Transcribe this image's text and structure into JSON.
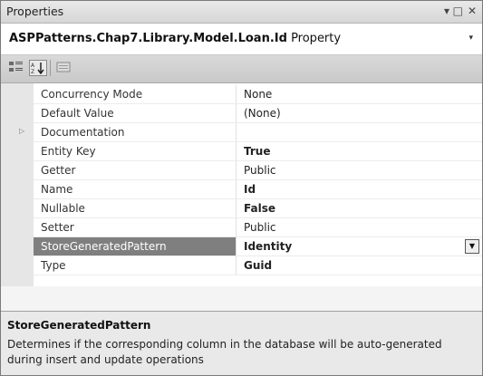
{
  "window": {
    "title": "Properties",
    "controls": {
      "dropdown_glyph": "▾",
      "pin_glyph": "□",
      "close_glyph": "✕"
    }
  },
  "object_selector": {
    "object_name": "ASPPatterns.Chap7.Library.Model.Loan.Id",
    "object_type": "Property",
    "arrow_glyph": "▾"
  },
  "toolbar": {
    "buttons": [
      {
        "name": "categorized",
        "icon": "categorized-icon",
        "selected": false
      },
      {
        "name": "alphabetical",
        "icon": "alphabetical-sort-icon",
        "selected": true
      },
      {
        "name": "property-pages",
        "icon": "property-pages-icon",
        "selected": false
      }
    ]
  },
  "properties": [
    {
      "name": "Concurrency Mode",
      "value": "None",
      "bold": false
    },
    {
      "name": "Default Value",
      "value": "(None)",
      "bold": false
    },
    {
      "name": "Documentation",
      "value": "",
      "bold": false,
      "expander": "▷"
    },
    {
      "name": "Entity Key",
      "value": "True",
      "bold": true
    },
    {
      "name": "Getter",
      "value": "Public",
      "bold": false
    },
    {
      "name": "Name",
      "value": "Id",
      "bold": true
    },
    {
      "name": "Nullable",
      "value": "False",
      "bold": true
    },
    {
      "name": "Setter",
      "value": "Public",
      "bold": false
    },
    {
      "name": "StoreGeneratedPattern",
      "value": "Identity",
      "bold": true,
      "selected": true,
      "dropdown_glyph": "▼"
    },
    {
      "name": "Type",
      "value": "Guid",
      "bold": true
    }
  ],
  "description": {
    "title": "StoreGeneratedPattern",
    "text": "Determines if the corresponding column in the database will be auto-generated during insert and update operations"
  },
  "colors": {
    "selected_row": "#7f7f7f",
    "gutter": "#e6e6e6",
    "toolbar": "#d0d0d0",
    "description_bg": "#e9e9e9"
  }
}
